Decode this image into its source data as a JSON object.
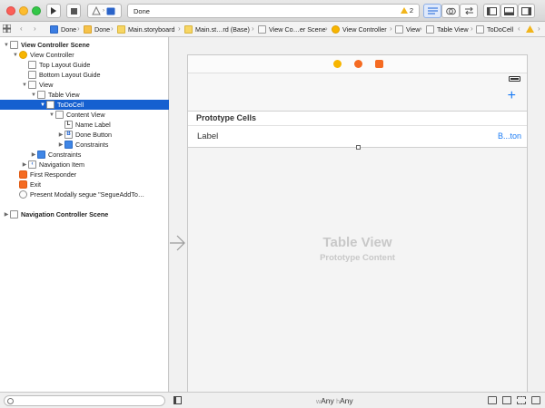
{
  "toolbar": {
    "status_text": "Done",
    "warning_count": "2"
  },
  "jumpbar": {
    "crumbs": [
      "Done",
      "Done",
      "Main.storyboard",
      "Main.st…rd (Base)",
      "View Co…er Scene",
      "View Controller",
      "View",
      "Table View",
      "ToDoCell"
    ]
  },
  "outline": {
    "items": [
      {
        "label": "View Controller Scene",
        "depth": 0,
        "bold": true,
        "open": true
      },
      {
        "label": "View Controller",
        "depth": 1,
        "open": true
      },
      {
        "label": "Top Layout Guide",
        "depth": 2
      },
      {
        "label": "Bottom Layout Guide",
        "depth": 2
      },
      {
        "label": "View",
        "depth": 2,
        "open": true
      },
      {
        "label": "Table View",
        "depth": 3,
        "open": true
      },
      {
        "label": "ToDoCell",
        "depth": 4,
        "open": true,
        "selected": true
      },
      {
        "label": "Content View",
        "depth": 5,
        "open": true
      },
      {
        "label": "Name Label",
        "depth": 6
      },
      {
        "label": "Done Button",
        "depth": 6,
        "closed": true
      },
      {
        "label": "Constraints",
        "depth": 6,
        "closed": true
      },
      {
        "label": "Constraints",
        "depth": 3,
        "closed": true
      },
      {
        "label": "Navigation Item",
        "depth": 3,
        "closed": true
      },
      {
        "label": "First Responder",
        "depth": 1
      },
      {
        "label": "Exit",
        "depth": 1
      },
      {
        "label": "Present Modally segue \"SegueAddTo…",
        "depth": 1
      },
      {
        "label": "Navigation Controller Scene",
        "depth": 0,
        "bold": true,
        "closed": true
      }
    ]
  },
  "canvas": {
    "prototype_cells": "Prototype Cells",
    "cell_label": "Label",
    "cell_button": "B...ton",
    "table_view_title": "Table View",
    "table_view_subtitle": "Prototype Content"
  },
  "bottombar": {
    "size_w": "w",
    "size_any_1": "Any",
    "size_h": "h",
    "size_any_2": "Any"
  }
}
